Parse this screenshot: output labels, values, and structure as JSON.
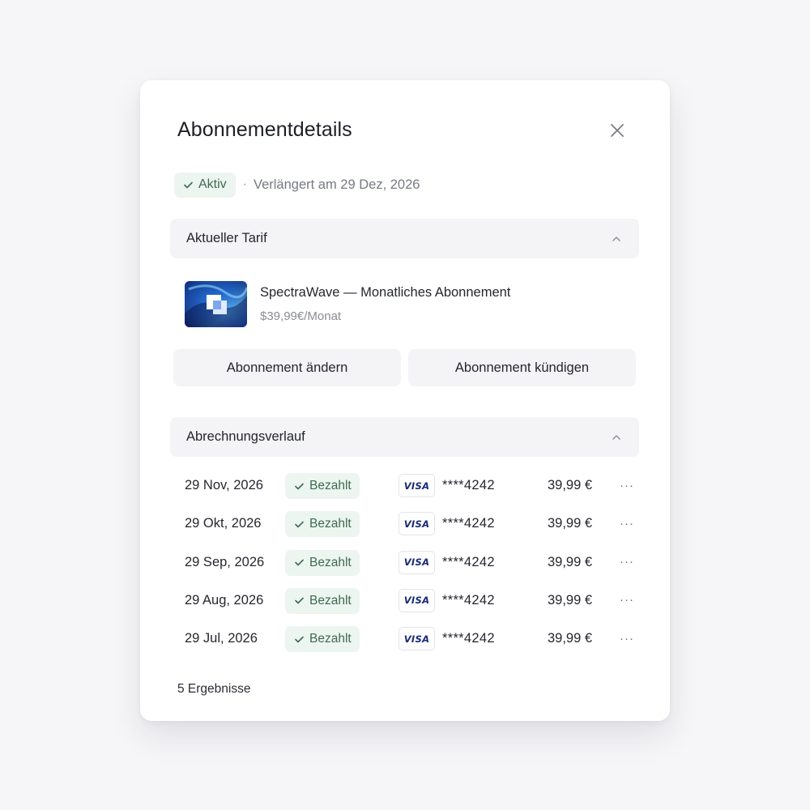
{
  "modal": {
    "title": "Abonnementdetails",
    "close_icon": "close-icon"
  },
  "status": {
    "badge_label": "Aktiv",
    "separator": "·",
    "renewal_text": "Verlängert am 29 Dez, 2026"
  },
  "current_plan": {
    "section_label": "Aktueller Tarif",
    "collapse_icon": "chevron-up-icon",
    "plan_name": "SpectraWave — Monatliches Abonnement",
    "plan_price": "$39,99€/Monat",
    "change_button": "Abonnement ändern",
    "cancel_button": "Abonnement kündigen"
  },
  "billing": {
    "section_label": "Abrechnungsverlauf",
    "collapse_icon": "chevron-up-icon",
    "rows": [
      {
        "date": "29 Nov, 2026",
        "status": "Bezahlt",
        "card_brand": "VISA",
        "card": "****4242",
        "amount": "39,99 €",
        "more": "···"
      },
      {
        "date": "29 Okt, 2026",
        "status": "Bezahlt",
        "card_brand": "VISA",
        "card": "****4242",
        "amount": "39,99 €",
        "more": "···"
      },
      {
        "date": "29 Sep, 2026",
        "status": "Bezahlt",
        "card_brand": "VISA",
        "card": "****4242",
        "amount": "39,99 €",
        "more": "···"
      },
      {
        "date": "29 Aug, 2026",
        "status": "Bezahlt",
        "card_brand": "VISA",
        "card": "****4242",
        "amount": "39,99 €",
        "more": "···"
      },
      {
        "date": "29 Jul, 2026",
        "status": "Bezahlt",
        "card_brand": "VISA",
        "card": "****4242",
        "amount": "39,99 €",
        "more": "···"
      }
    ],
    "results_text": "5 Ergebnisse"
  },
  "colors": {
    "badge_bg": "#ecf5ef",
    "badge_text": "#3f6b52",
    "section_bg": "#f4f4f7",
    "visa_blue": "#1a2a7a"
  }
}
